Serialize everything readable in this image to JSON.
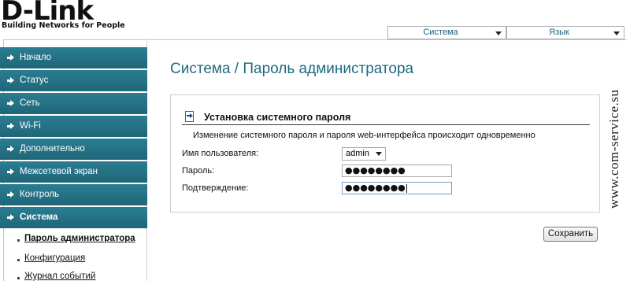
{
  "brand": {
    "name": "D-Link",
    "tagline": "Building Networks for People"
  },
  "topbar": {
    "system_select": "Система",
    "language_select": "Язык"
  },
  "nav": {
    "items": [
      {
        "label": "Начало"
      },
      {
        "label": "Статус"
      },
      {
        "label": "Сеть"
      },
      {
        "label": "Wi-Fi"
      },
      {
        "label": "Дополнительно"
      },
      {
        "label": "Межсетевой экран"
      },
      {
        "label": "Контроль"
      },
      {
        "label": "Система"
      }
    ],
    "subitems": [
      {
        "label": "Пароль администратора"
      },
      {
        "label": "Конфигурация"
      },
      {
        "label": "Журнал событий"
      }
    ]
  },
  "page": {
    "title": "Система  / Пароль администратора"
  },
  "panel": {
    "title": "Установка системного пароля",
    "description": "Изменение системного пароля и пароля web-интерфейса происходит одновременно",
    "username_label": "Имя пользователя:",
    "username_value": "admin",
    "password_label": "Пароль:",
    "password_value": "●●●●●●●●",
    "confirm_label": "Подтверждение:",
    "confirm_value": "●●●●●●●●"
  },
  "actions": {
    "save_label": "Сохранить"
  },
  "watermark": "www.com-service.su",
  "colors": {
    "nav_bg": "#236f84",
    "title": "#1e6a7e",
    "select_text": "#1a5e7a"
  }
}
